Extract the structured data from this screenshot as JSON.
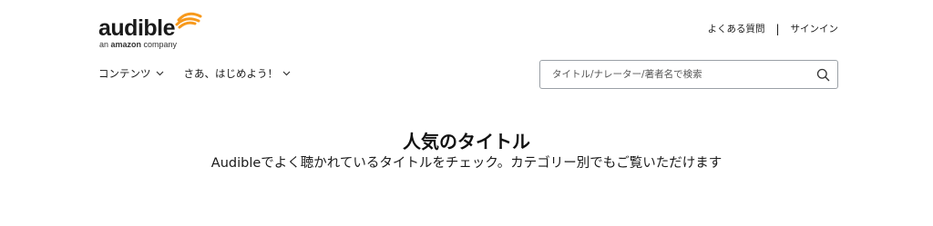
{
  "logo": {
    "wordmark": "audible",
    "tagline_prefix": "an ",
    "tagline_brand": "amazon",
    "tagline_suffix": " company",
    "accent_color": "#f7991c"
  },
  "header_links": {
    "faq": "よくある質問",
    "separator": "|",
    "sign_in": "サインイン"
  },
  "nav": {
    "items": [
      {
        "label": "コンテンツ",
        "icon": "chevron-down-icon"
      },
      {
        "label": "さあ、はじめよう！",
        "icon": "chevron-down-icon"
      }
    ]
  },
  "search": {
    "placeholder": "タイトル/ナレーター/著者名で検索",
    "value": "",
    "icon": "search-icon"
  },
  "hero": {
    "title": "人気のタイトル",
    "subtitle": "Audibleでよく聴かれているタイトルをチェック。カテゴリー別でもご覧いただけます"
  }
}
